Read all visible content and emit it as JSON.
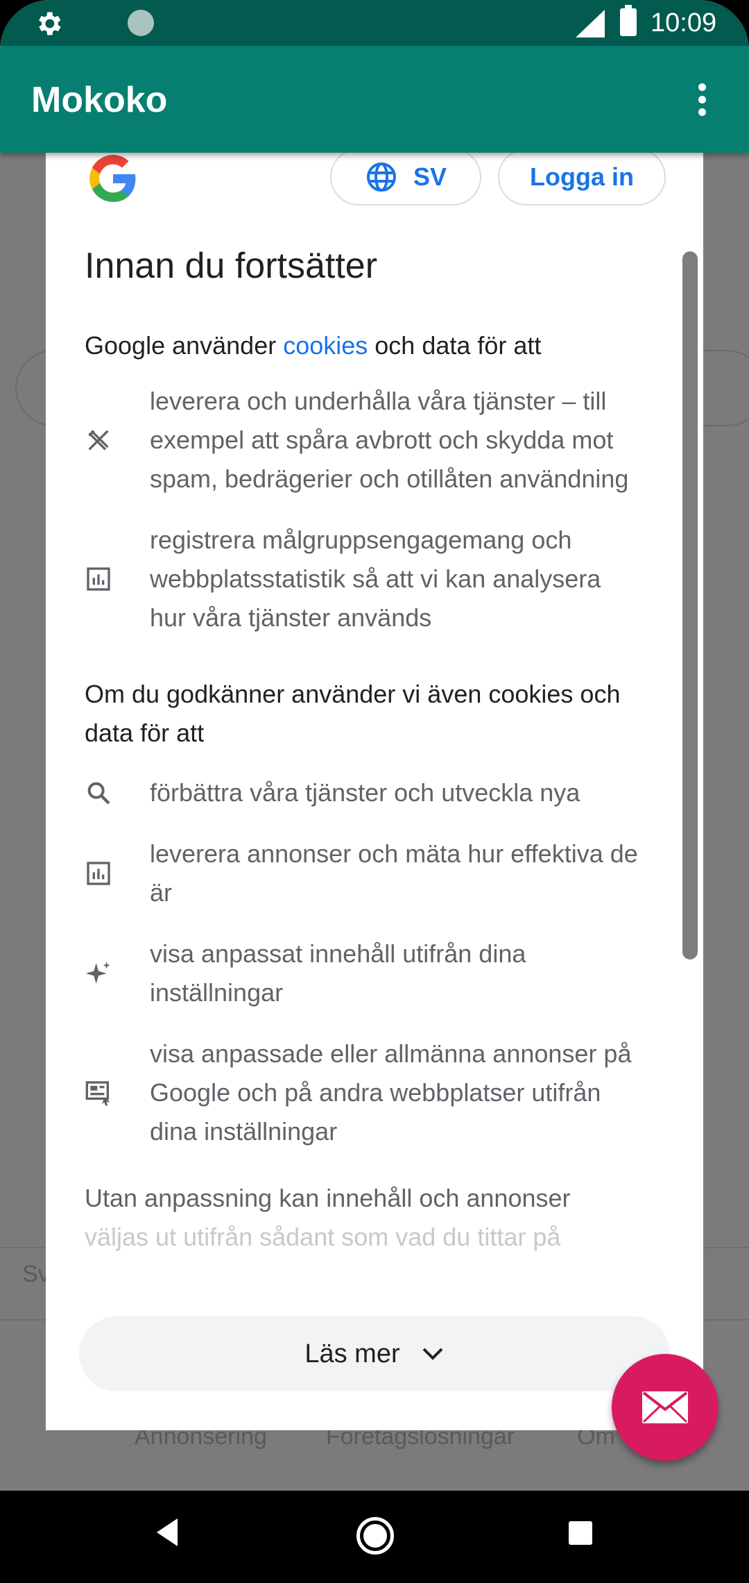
{
  "status_bar": {
    "time": "10:09"
  },
  "app_bar": {
    "title": "Mokoko",
    "menu_icon": "more-vert-icon"
  },
  "background": {
    "bottom_links": [
      "Annonsering",
      "Företagslösningar",
      "Om"
    ],
    "left_fragment": "Sv"
  },
  "dialog": {
    "language_label": "SV",
    "login_label": "Logga in",
    "heading": "Innan du fortsätter",
    "intro_prefix": "Google använder ",
    "intro_link": "cookies",
    "intro_suffix": " och data för att",
    "items_required": [
      {
        "icon": "tools-icon",
        "text": "leverera och underhålla våra tjänster – till exempel att spåra avbrott och skydda mot spam, bedrägerier och otillåten användning"
      },
      {
        "icon": "bar-chart-icon",
        "text": "registrera målgruppsengagemang och webbplatsstatistik så att vi kan analysera hur våra tjänster används"
      }
    ],
    "section_text": "Om du godkänner använder vi även cookies och data för att",
    "items_optional": [
      {
        "icon": "search-icon",
        "text": "förbättra våra tjänster och utveckla nya"
      },
      {
        "icon": "bar-chart-icon",
        "text": "leverera annonser och mäta hur effektiva de är"
      },
      {
        "icon": "sparkle-icon",
        "text": "visa anpassat innehåll utifrån dina inställningar"
      },
      {
        "icon": "ad-icon",
        "text": "visa anpassade eller allmänna annonser på Google och på andra webbplatser utifrån dina inställningar"
      }
    ],
    "fade_line_1": "Utan anpassning kan innehåll och annonser",
    "fade_line_2": "väljas ut utifrån sådant som vad du tittar på",
    "more_label": "Läs mer"
  },
  "colors": {
    "app_bar": "#067f71",
    "status_bar": "#035a4f",
    "link": "#1a73e8",
    "fab": "#d81b60"
  }
}
